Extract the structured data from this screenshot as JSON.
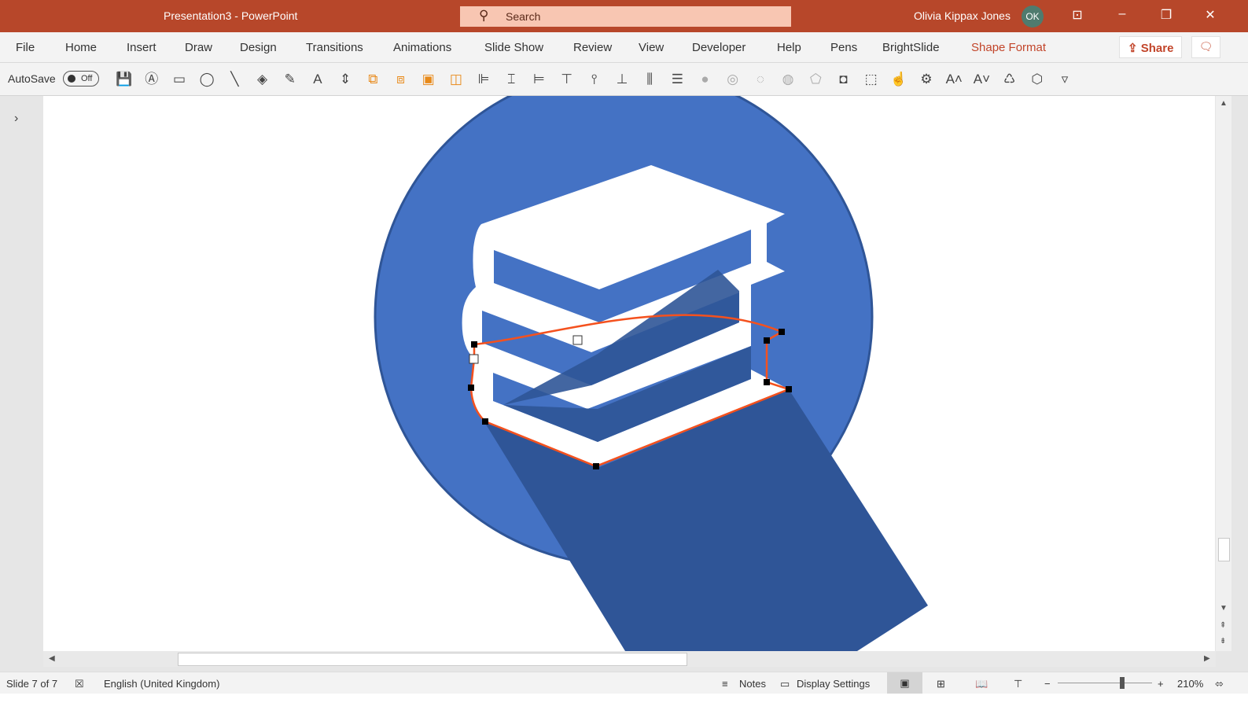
{
  "window": {
    "title": "Presentation3  -  PowerPoint",
    "search_placeholder": "Search",
    "user": "Olivia Kippax Jones",
    "avatar_initials": "OK",
    "accent": "#b7472a"
  },
  "tabs": [
    {
      "label": "File"
    },
    {
      "label": "Home"
    },
    {
      "label": "Insert"
    },
    {
      "label": "Draw"
    },
    {
      "label": "Design"
    },
    {
      "label": "Transitions"
    },
    {
      "label": "Animations"
    },
    {
      "label": "Slide Show"
    },
    {
      "label": "Review"
    },
    {
      "label": "View"
    },
    {
      "label": "Developer"
    },
    {
      "label": "Help"
    },
    {
      "label": "Pens"
    },
    {
      "label": "BrightSlide"
    },
    {
      "label": "Shape Format",
      "active": true
    }
  ],
  "share_label": "Share",
  "toolbar": {
    "autosave_label": "AutoSave",
    "autosave_state": "Off",
    "icons": [
      "save-icon",
      "text-box-icon",
      "rectangle-icon",
      "oval-icon",
      "line-icon",
      "shape-fill-icon",
      "shape-outline-icon",
      "font-color-icon",
      "resize-icon",
      "bring-forward-icon",
      "group-icon",
      "bring-to-front-icon",
      "send-to-back-icon",
      "align-left-icon",
      "align-center-icon",
      "align-right-icon",
      "align-top-icon",
      "align-middle-icon",
      "align-bottom-icon",
      "distribute-horizontal-icon",
      "distribute-vertical-icon",
      "merge-union-icon",
      "merge-combine-icon",
      "merge-fragment-icon",
      "merge-intersect-icon",
      "edit-points-icon",
      "change-shape-icon",
      "selection-pane-icon",
      "touch-mode-icon",
      "settings-icon",
      "increase-font-icon",
      "decrease-font-icon",
      "recolor-icon",
      "edit-shape-icon",
      "customize-toolbar-icon"
    ]
  },
  "slide": {
    "circle_color": "#4472c4",
    "shadow_color": "#2f5597",
    "outline_color": "#f4511e"
  },
  "status": {
    "slide": "Slide 7 of 7",
    "language": "English (United Kingdom)",
    "notes": "Notes",
    "display_settings": "Display Settings",
    "zoom": "210%"
  }
}
